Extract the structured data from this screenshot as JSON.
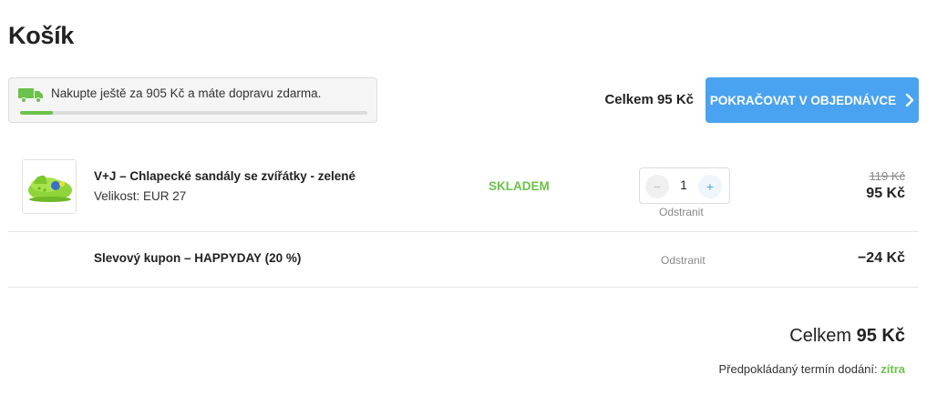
{
  "page": {
    "title": "Košík"
  },
  "shipping": {
    "message": "Nakupte ještě za 905 Kč a máte dopravu zdarma.",
    "progress": 0.095,
    "icon": "truck-icon",
    "accent_color": "#6cc24a"
  },
  "summary_top": {
    "total_label": "Celkem 95 Kč",
    "continue_label": "POKRAČOVAT V OBJEDNÁVCE",
    "button_color": "#4aa3f0"
  },
  "product": {
    "name": "V+J – Chlapecké sandály se zvířátky - zelené",
    "size": "Velikost: EUR 27",
    "stock_status": "SKLADEM",
    "quantity": "1",
    "minus": "−",
    "plus": "+",
    "remove_label": "Odstranit",
    "price_old": "119 Kč",
    "price_current": "95 Kč"
  },
  "coupon": {
    "name": "Slevový kupon – HAPPYDAY (20 %)",
    "remove_label": "Odstranit",
    "amount": "−24 Kč"
  },
  "summary_bottom": {
    "total_prefix": "Celkem",
    "total_value": "95 Kč",
    "delivery_label": "Předpokládaný termín dodání:",
    "delivery_value": "zítra"
  }
}
